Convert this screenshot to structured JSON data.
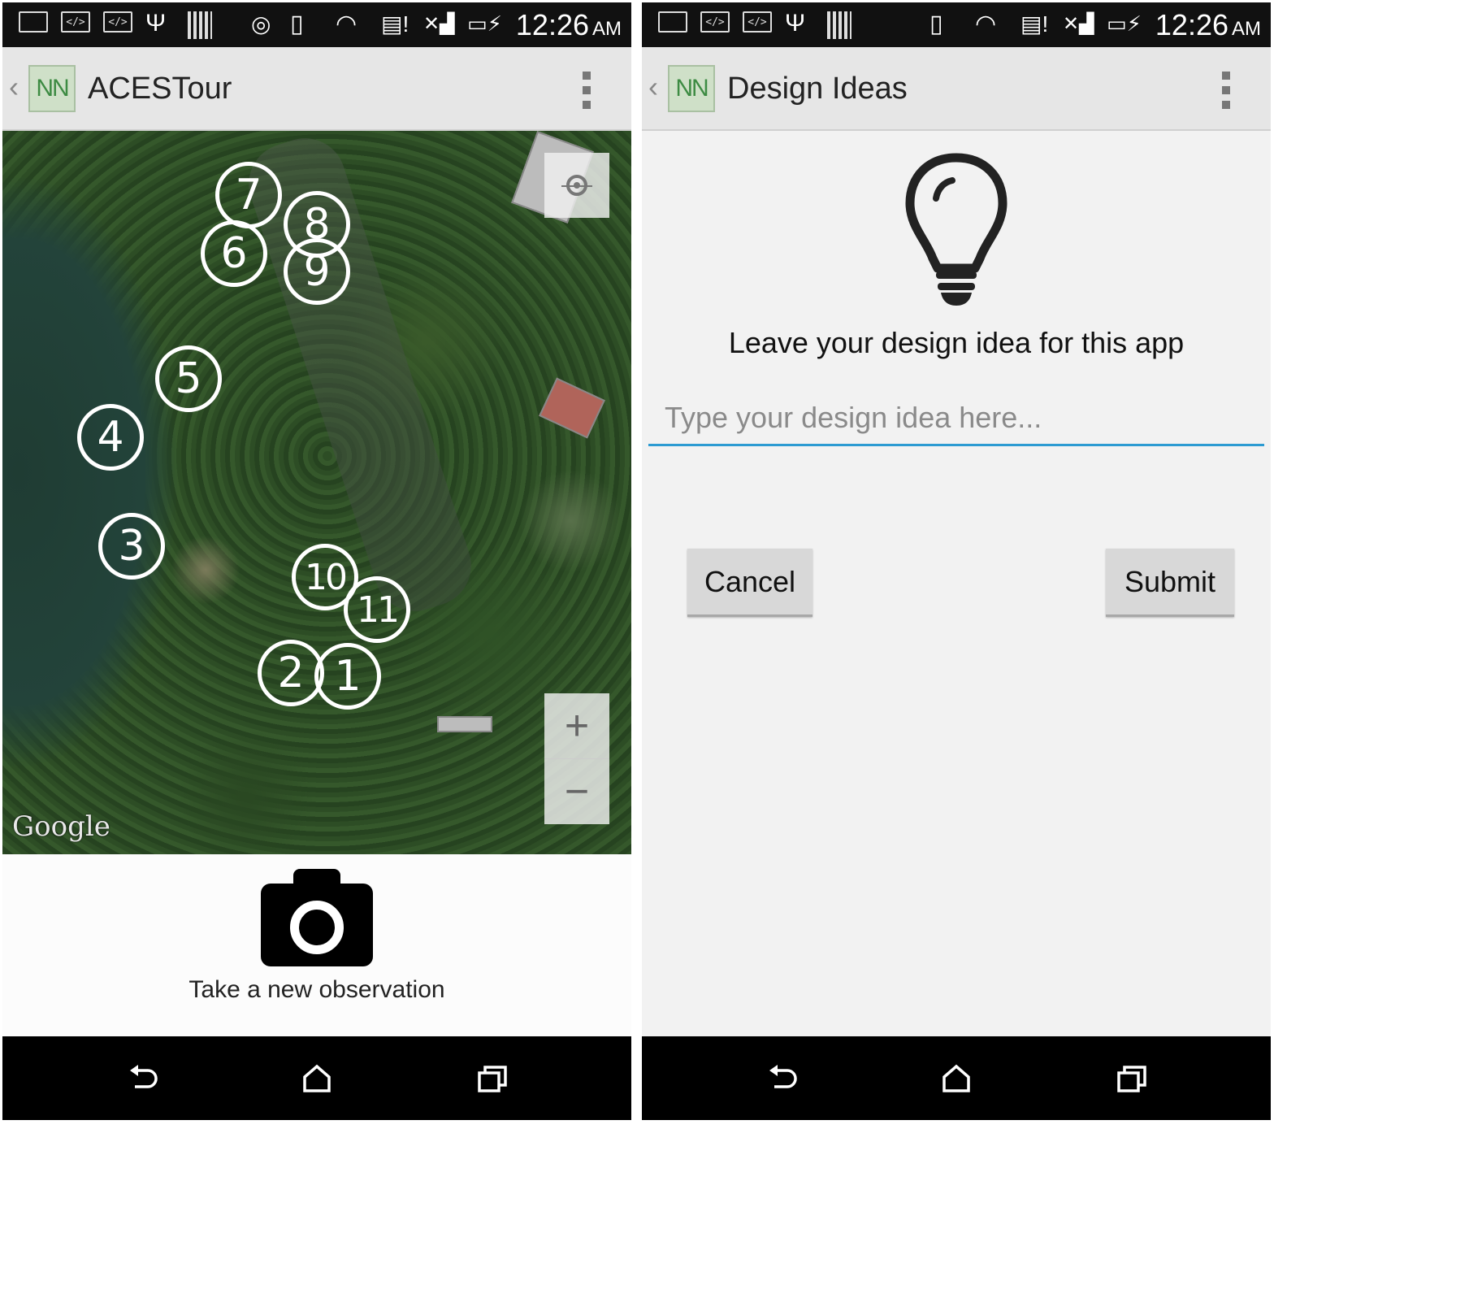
{
  "status_bar": {
    "time": "12:26",
    "ampm": "AM"
  },
  "left_screen": {
    "title": "ACESTour",
    "logo_text": "NN",
    "map": {
      "markers": [
        "7",
        "8",
        "6",
        "9",
        "5",
        "4",
        "3",
        "10",
        "11",
        "2",
        "1"
      ],
      "zoom_in": "+",
      "zoom_out": "−",
      "attribution": "Google"
    },
    "camera_label": "Take a new observation"
  },
  "right_screen": {
    "title": "Design Ideas",
    "logo_text": "NN",
    "prompt": "Leave your design idea for this app",
    "input_placeholder": "Type your design idea here...",
    "input_value": "",
    "cancel_label": "Cancel",
    "submit_label": "Submit"
  },
  "colors": {
    "accent": "#2c9bd2",
    "action_bar": "#e6e6e6",
    "logo_green": "#3d8b43"
  },
  "icons": [
    "back-chevron-icon",
    "overflow-menu-icon",
    "my-location-icon",
    "camera-icon",
    "lightbulb-icon",
    "nav-back-icon",
    "nav-home-icon",
    "nav-recents-icon"
  ]
}
